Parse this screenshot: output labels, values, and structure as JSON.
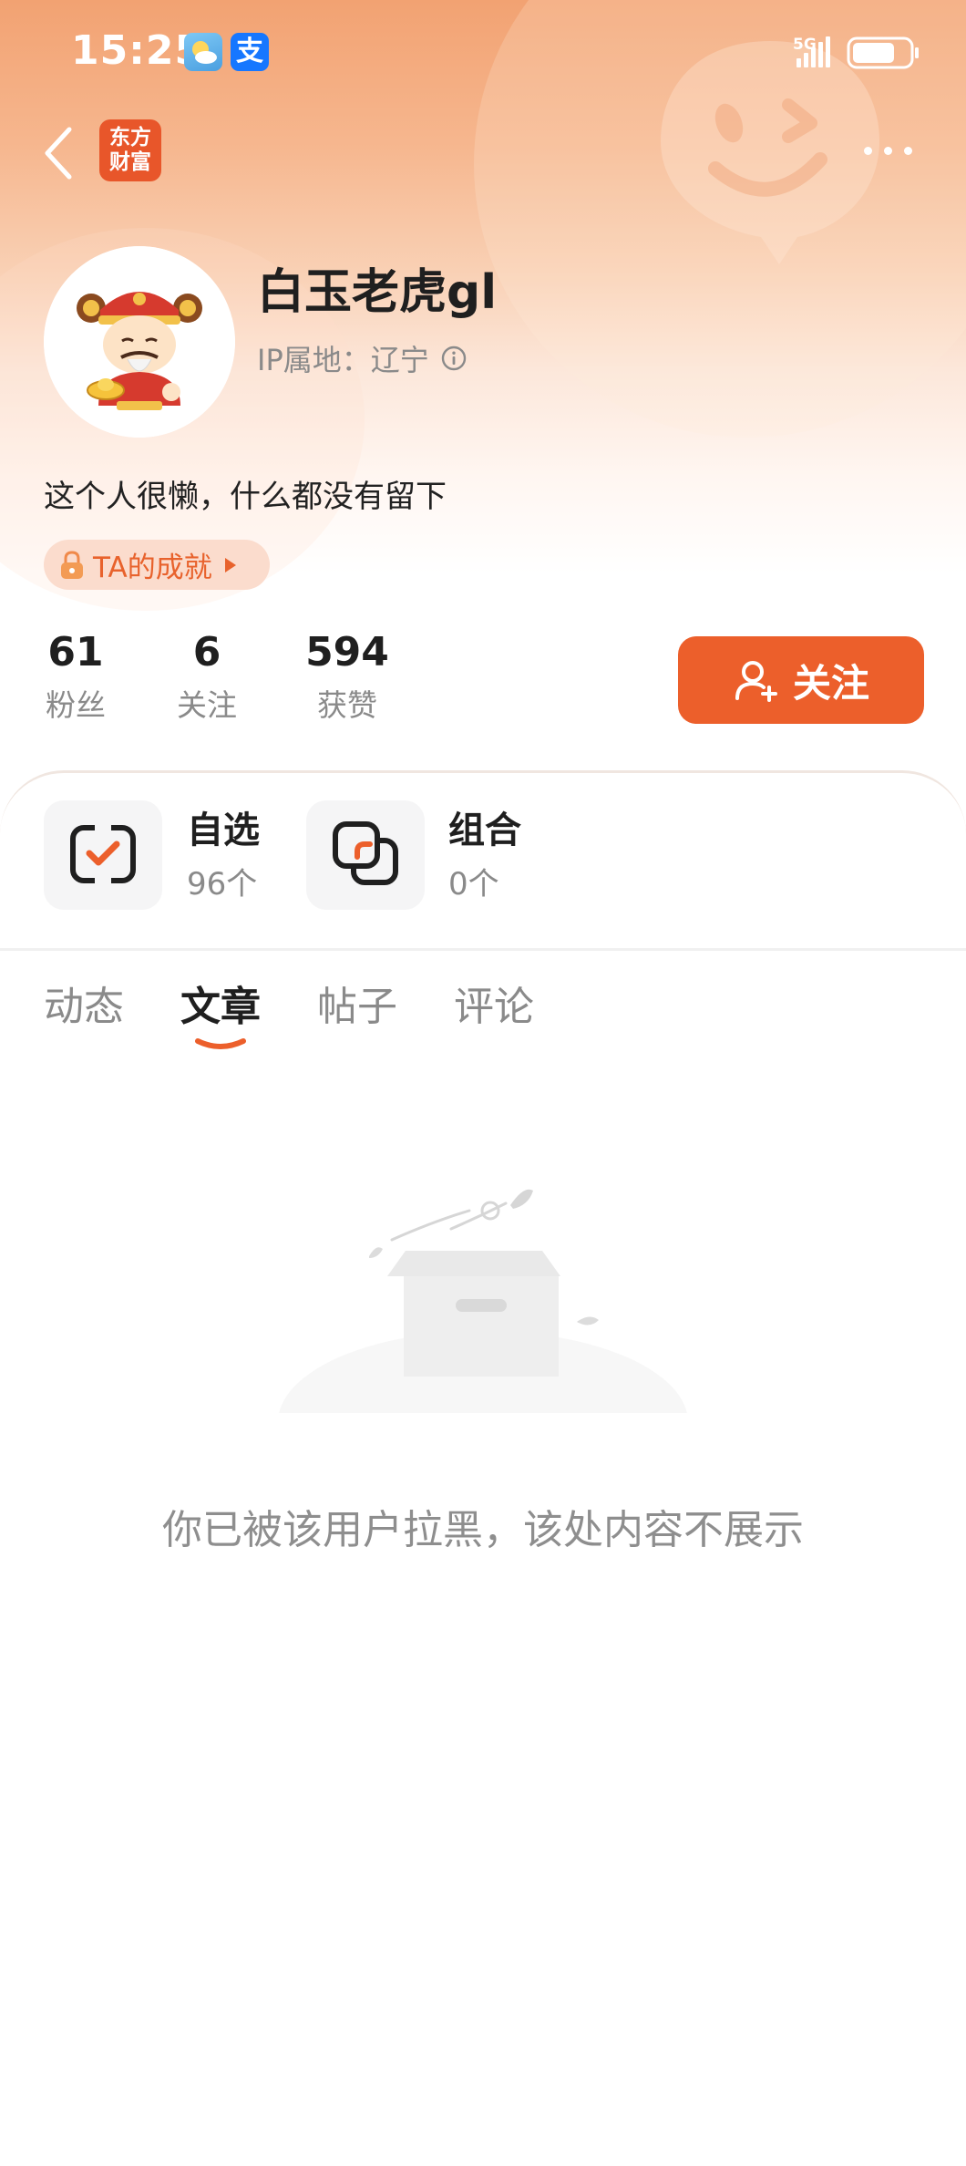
{
  "status_bar": {
    "time": "15:25",
    "network": "5G",
    "alipay_glyph": "支",
    "icons": [
      "weather-icon",
      "alipay-icon",
      "signal-icon",
      "battery-icon"
    ]
  },
  "nav": {
    "brand_line1": "东方",
    "brand_line2": "财富",
    "back_icon": "chevron-left-icon",
    "more_icon": "more-horizontal-icon"
  },
  "profile": {
    "username": "白玉老虎gl",
    "ip_location": "IP属地：辽宁",
    "bio": "这个人很懒，什么都没有留下",
    "achievement_label": "TA的成就"
  },
  "stats": [
    {
      "value": "61",
      "label": "粉丝"
    },
    {
      "value": "6",
      "label": "关注"
    },
    {
      "value": "594",
      "label": "获赞"
    }
  ],
  "follow_button": {
    "label": "关注"
  },
  "tools": [
    {
      "title": "自选",
      "count": "96个",
      "icon": "watchlist-icon"
    },
    {
      "title": "组合",
      "count": "0个",
      "icon": "portfolio-icon"
    }
  ],
  "tabs": [
    {
      "label": "动态",
      "active": false
    },
    {
      "label": "文章",
      "active": true
    },
    {
      "label": "帖子",
      "active": false
    },
    {
      "label": "评论",
      "active": false
    }
  ],
  "empty_state": {
    "message": "你已被该用户拉黑，该处内容不展示",
    "icon": "empty-box-icon"
  },
  "colors": {
    "accent": "#ec5f2b",
    "header_gradient_top": "#f2a272",
    "text_primary": "#1f1f1f",
    "text_secondary": "#8a8a8a"
  }
}
